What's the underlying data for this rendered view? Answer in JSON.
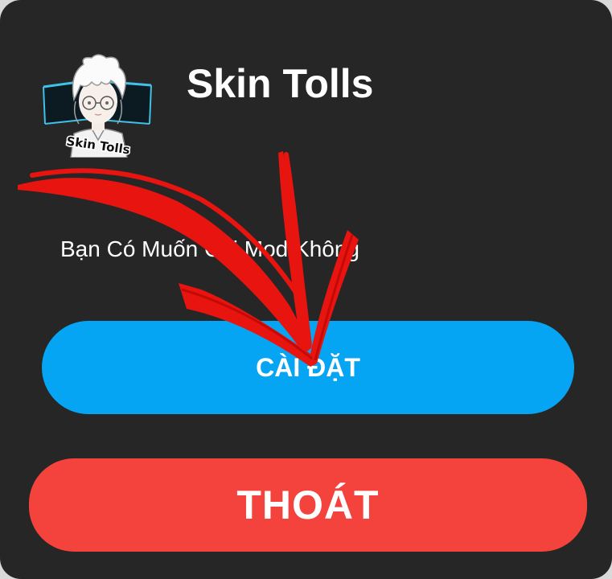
{
  "dialog": {
    "title": "Skin Tolls",
    "icon_caption": "Skin Tolls",
    "message": "Bạn Có Muốn Cài Mod Không",
    "install_button_label": "CÀI ĐẶT",
    "exit_button_label": "THOÁT"
  },
  "colors": {
    "dialog_background": "#262626",
    "install_button": "#06a5f4",
    "exit_button": "#f4433c",
    "annotation_arrow": "#e8140f"
  },
  "icons": {
    "app_icon": "anime-character-avatar-icon",
    "annotation": "red-arrow-annotation"
  }
}
